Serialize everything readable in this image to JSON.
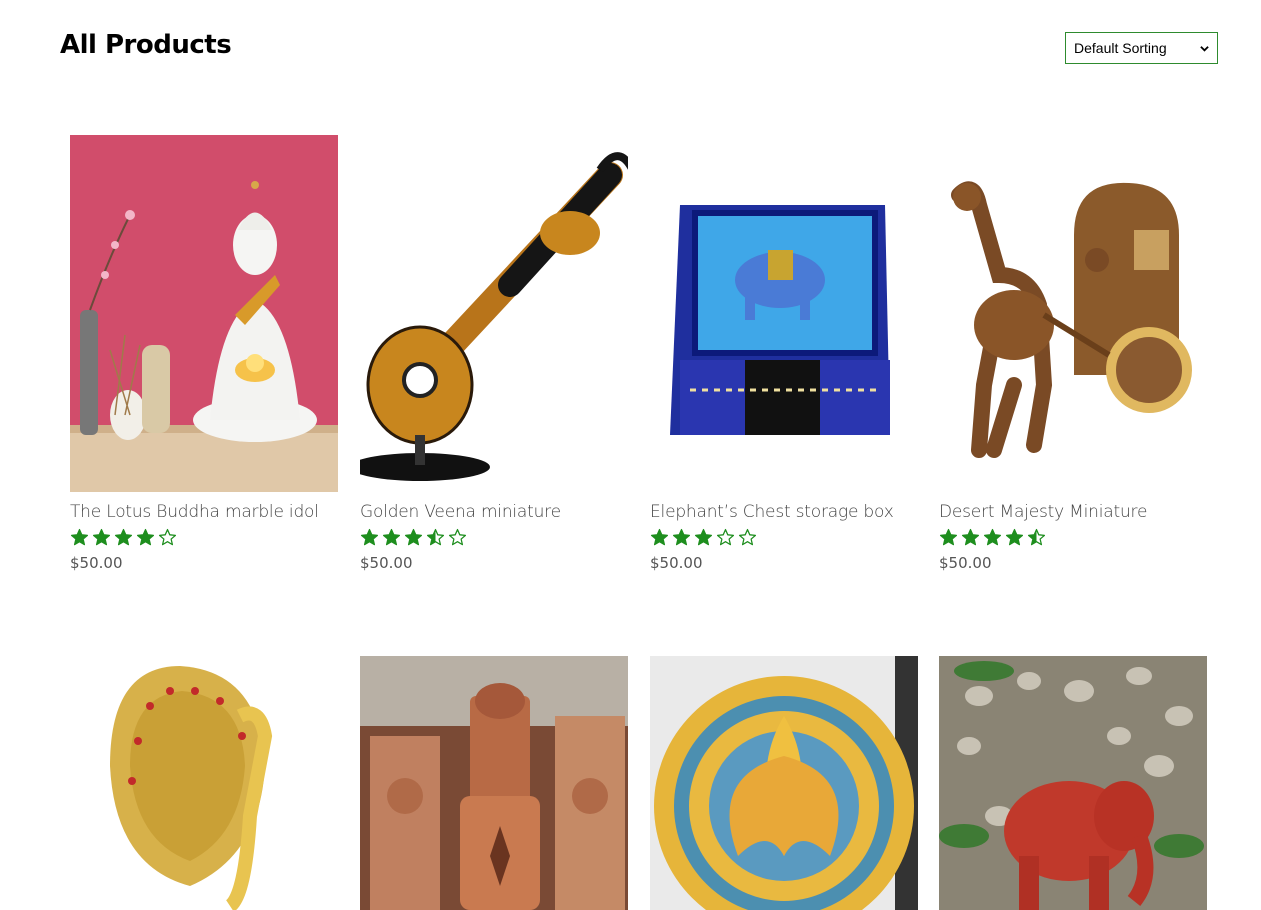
{
  "page": {
    "title": "All Products",
    "sort": {
      "selected": "Default Sorting"
    },
    "accent_color": "#1e8e1e"
  },
  "products": [
    {
      "name": "The Lotus Buddha marble idol",
      "rating": 4,
      "price": "$50.00",
      "image": "buddha-idol"
    },
    {
      "name": "Golden Veena miniature",
      "rating": 3.5,
      "price": "$50.00",
      "image": "veena"
    },
    {
      "name": "Elephant’s Chest storage box",
      "rating": 3,
      "price": "$50.00",
      "image": "elephant-box"
    },
    {
      "name": "Desert Majesty Miniature",
      "rating": 4.5,
      "price": "$50.00",
      "image": "camel-cart"
    },
    {
      "name": "",
      "rating": null,
      "price": "",
      "image": "peacock"
    },
    {
      "name": "",
      "rating": null,
      "price": "",
      "image": "terracotta-lanterns"
    },
    {
      "name": "",
      "rating": null,
      "price": "",
      "image": "mandala-lotus"
    },
    {
      "name": "",
      "rating": null,
      "price": "",
      "image": "red-elephant"
    }
  ]
}
